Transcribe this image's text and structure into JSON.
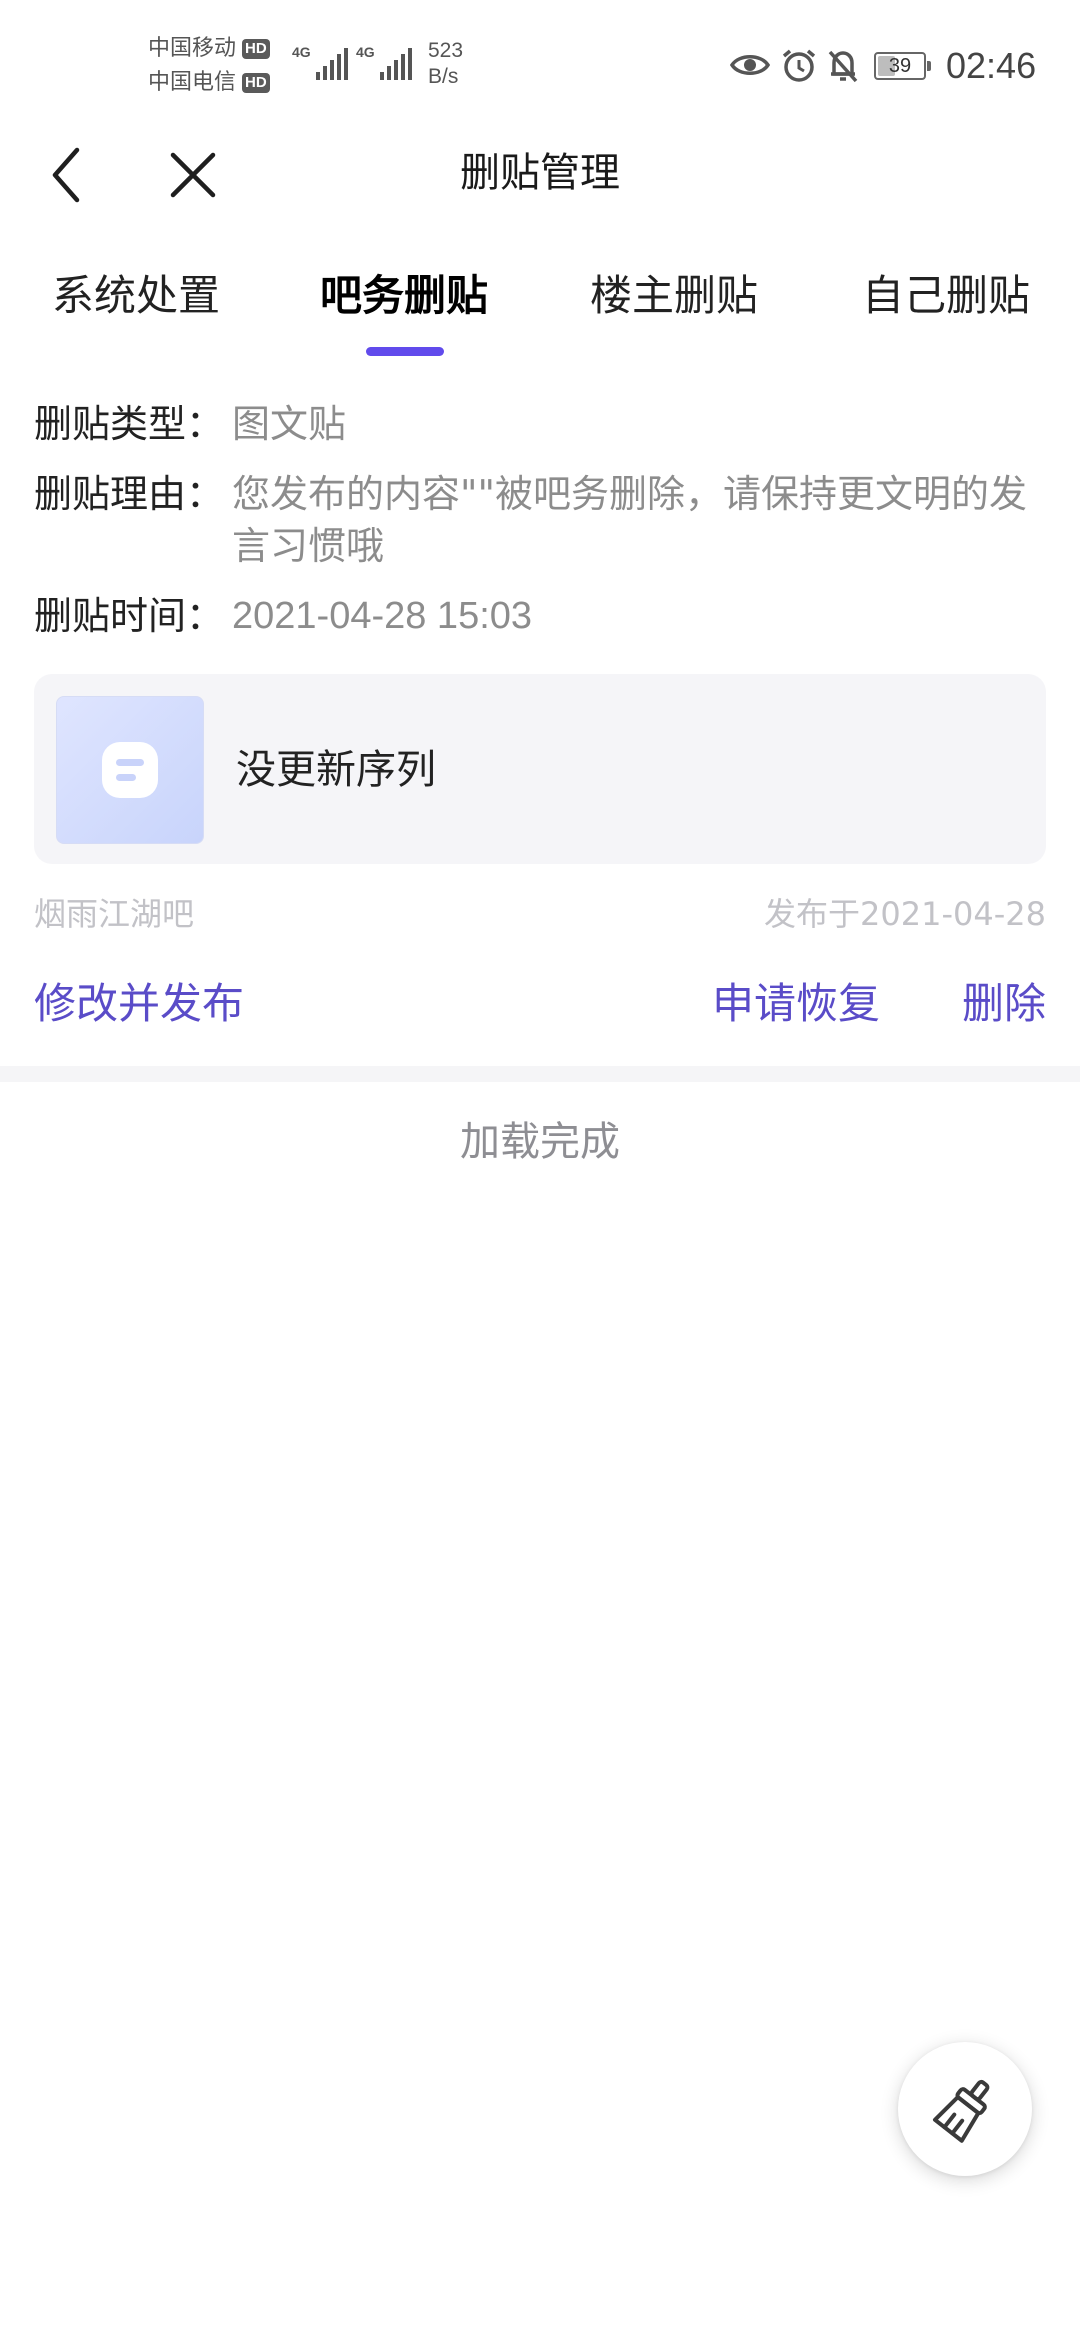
{
  "status_bar": {
    "carrier1": "中国移动",
    "carrier2": "中国电信",
    "hd_badge": "HD",
    "net_type": "4G",
    "speed_value": "523",
    "speed_unit": "B/s",
    "battery": "39",
    "battery_level": 0.39,
    "time": "02:46",
    "icons": [
      "eye-icon",
      "alarm-icon",
      "bell-off-icon"
    ]
  },
  "header": {
    "title": "删贴管理",
    "back_icon": "chevron-left-icon",
    "close_icon": "close-icon"
  },
  "tabs": [
    {
      "label": "系统处置",
      "active": false
    },
    {
      "label": "吧务删贴",
      "active": true
    },
    {
      "label": "楼主删贴",
      "active": false
    },
    {
      "label": "自己删贴",
      "active": false
    }
  ],
  "details": {
    "type_label": "删贴类型：",
    "type_value": "图文贴",
    "reason_label": "删贴理由：",
    "reason_value": "您发布的内容\"\"被吧务删除，请保持更文明的发言习惯哦",
    "time_label": "删贴时间：",
    "time_value": "2021-04-28 15:03"
  },
  "post": {
    "title": "没更新序列",
    "bar_name": "烟雨江湖吧",
    "published": "发布于2021-04-28"
  },
  "actions": {
    "edit_publish": "修改并发布",
    "appeal": "申请恢复",
    "delete": "删除"
  },
  "footer": {
    "load_status": "加载完成"
  },
  "fab": {
    "icon": "broom-icon"
  },
  "colors": {
    "accent": "#614bec",
    "action_text": "#5a4cc8",
    "muted_text": "#8c8c8c",
    "meta_text": "#c2c2c7",
    "card_bg": "#f5f5f8"
  }
}
